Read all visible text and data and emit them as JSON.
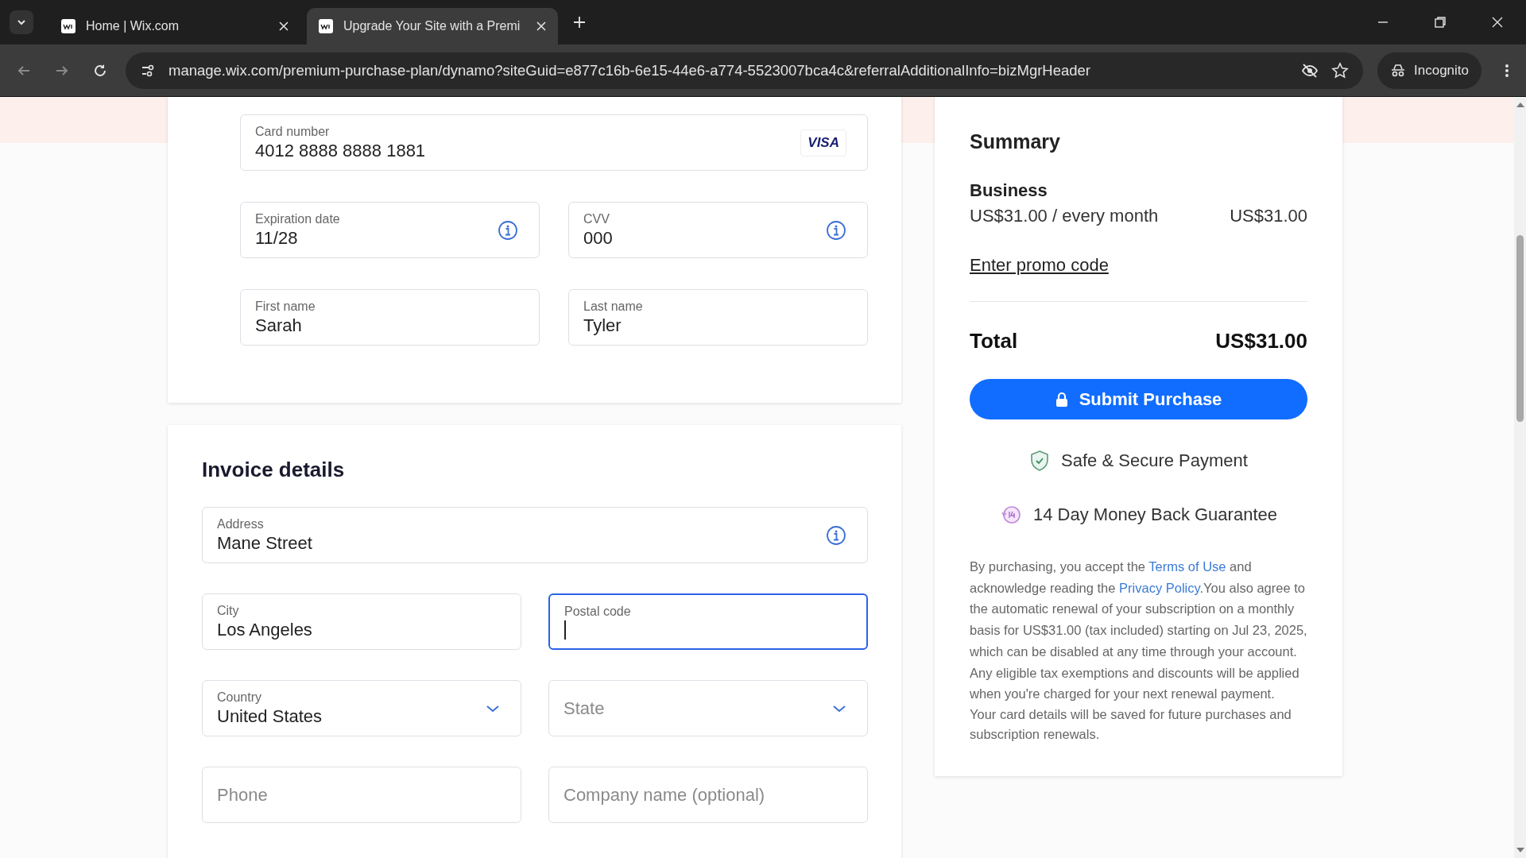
{
  "browser": {
    "tabs": [
      {
        "title": "Home | Wix.com",
        "selected": false
      },
      {
        "title": "Upgrade Your Site with a Premi",
        "selected": true
      }
    ],
    "url": "manage.wix.com/premium-purchase-plan/dynamo?siteGuid=e877c16b-6e15-44e6-a774-5523007bca4c&referralAdditionalInfo=bizMgrHeader",
    "profile": "Incognito"
  },
  "payment": {
    "card_number": {
      "label": "Card number",
      "value": "4012 8888 8888 1881",
      "brand": "VISA"
    },
    "rows": [
      [
        {
          "label": "Expiration date",
          "value": "11/28",
          "info": true
        },
        {
          "label": "CVV",
          "value": "000",
          "info": true
        }
      ],
      [
        {
          "label": "First name",
          "value": "Sarah",
          "info": false
        },
        {
          "label": "Last name",
          "value": "Tyler",
          "info": false
        }
      ]
    ]
  },
  "invoice": {
    "title": "Invoice details",
    "fields": [
      {
        "kind": "text",
        "label": "Address",
        "value": "Mane Street",
        "info": true,
        "focused": false,
        "wide": true
      },
      {
        "kind": "text",
        "label": "City",
        "value": "Los Angeles",
        "info": false,
        "focused": false,
        "wide": false
      },
      {
        "kind": "text",
        "label": "Postal code",
        "info": false,
        "focused": true,
        "wide": false
      },
      {
        "kind": "select",
        "label": "Country",
        "value": "United States",
        "info": false,
        "focused": false,
        "wide": false
      },
      {
        "kind": "select",
        "placeholder": "State",
        "info": false,
        "focused": false,
        "wide": false
      },
      {
        "kind": "text",
        "placeholder": "Phone",
        "info": false,
        "focused": false,
        "wide": false
      },
      {
        "kind": "text",
        "placeholder": "Company name (optional)",
        "info": false,
        "focused": false,
        "wide": false
      }
    ]
  },
  "summary": {
    "title": "Summary",
    "plan": "Business",
    "price_line": "US$31.00 / every month",
    "price": "US$31.00",
    "promo_link": "Enter promo code",
    "total_label": "Total",
    "total": "US$31.00",
    "submit": "Submit Purchase",
    "badges": [
      {
        "kind": "shield",
        "text": "Safe & Secure Payment"
      },
      {
        "kind": "days",
        "text": "14 Day Money Back Guarantee"
      }
    ],
    "legal": [
      {
        "kind": "text",
        "text": "By purchasing, you accept the "
      },
      {
        "kind": "link",
        "text": "Terms of Use"
      },
      {
        "kind": "text",
        "text": " and acknowledge reading the "
      },
      {
        "kind": "link",
        "text": "Privacy Policy"
      },
      {
        "kind": "text",
        "text": ".You also agree to the automatic renewal of your subscription on a monthly basis for US$31.00 (tax included) starting on Jul 23, 2025, which can be disabled at any time through your account. Any eligible tax exemptions and discounts will be applied when you're charged for your next renewal payment."
      }
    ],
    "note": "Your card details will be saved for future purchases and subscription renewals."
  }
}
